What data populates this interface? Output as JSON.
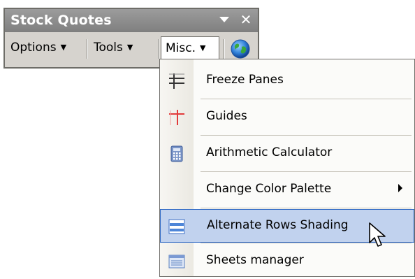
{
  "window": {
    "title": "Stock Quotes",
    "close_glyph": "✕"
  },
  "toolbar": {
    "options_label": "Options",
    "tools_label": "Tools",
    "misc_label": "Misc.",
    "dropdown_glyph": "▼"
  },
  "menu": {
    "items": [
      {
        "label": "Freeze Panes",
        "icon": "freeze-panes-icon"
      },
      {
        "label": "Guides",
        "icon": "guides-icon"
      },
      {
        "label": "Arithmetic Calculator",
        "icon": "calculator-icon"
      },
      {
        "label": "Change Color Palette",
        "icon": "",
        "submenu": true
      },
      {
        "label": "Alternate Rows Shading",
        "icon": "alternate-rows-icon",
        "highlighted": true
      },
      {
        "label": "Sheets manager",
        "icon": "sheets-manager-icon"
      }
    ]
  },
  "colors": {
    "titlebar": "#8c8c8c",
    "toolbar_bg": "#d6d3ce",
    "highlight": "#c1d2ee",
    "highlight_border": "#316ac5"
  }
}
